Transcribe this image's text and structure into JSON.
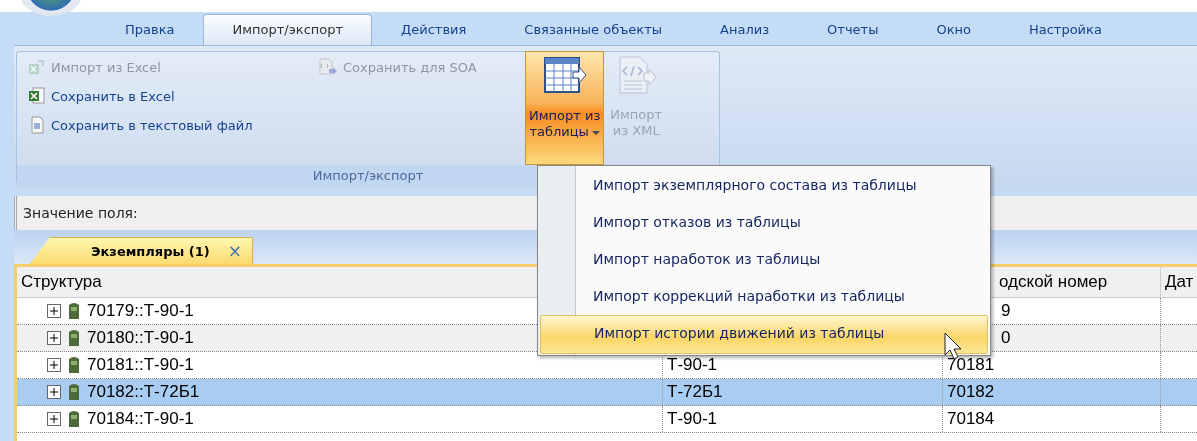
{
  "ribbon_tabs": [
    {
      "label": "Правка",
      "selected": false
    },
    {
      "label": "Импорт/экспорт",
      "selected": true
    },
    {
      "label": "Действия",
      "selected": false
    },
    {
      "label": "Связанные объекты",
      "selected": false
    },
    {
      "label": "Анализ",
      "selected": false
    },
    {
      "label": "Отчеты",
      "selected": false
    },
    {
      "label": "Окно",
      "selected": false
    },
    {
      "label": "Настройка",
      "selected": false
    }
  ],
  "ribbon_group": {
    "label": "Импорт/экспорт",
    "small_buttons": [
      {
        "label": "Импорт из Excel",
        "disabled": true
      },
      {
        "label": "Сохранить в Excel",
        "disabled": false
      },
      {
        "label": "Сохранить в текстовый файл",
        "disabled": false
      },
      {
        "label": "Сохранить для SOA",
        "disabled": true
      }
    ],
    "large_buttons": [
      {
        "label_line_1": "Импорт из",
        "label_line_2": "таблицы",
        "dropdown": true,
        "pressed": true,
        "disabled": false
      },
      {
        "label_line_1": "Импорт",
        "label_line_2": "из XML",
        "dropdown": false,
        "pressed": false,
        "disabled": true
      }
    ]
  },
  "dropdown_menu": [
    {
      "label": "Импорт экземплярного состава из таблицы",
      "highlighted": false
    },
    {
      "label": "Импорт отказов из таблицы",
      "highlighted": false
    },
    {
      "label": "Импорт наработок из таблицы",
      "highlighted": false
    },
    {
      "label": "Импорт коррекций наработки из таблицы",
      "highlighted": false
    },
    {
      "label": "Импорт истории движений из таблицы",
      "highlighted": true
    }
  ],
  "field_bar": {
    "label": "Значение поля:"
  },
  "document_tabs": [
    {
      "label": "Экземпляры (1)",
      "selected": true,
      "close": "×"
    }
  ],
  "table": {
    "columns": [
      "Структура",
      "одской номер",
      "Дат"
    ],
    "rows": [
      {
        "structure": "70179::Т-90-1",
        "column_3": "9",
        "selected": false
      },
      {
        "structure": "70180::Т-90-1",
        "column_3": "0",
        "selected": false
      },
      {
        "structure": "70181::Т-90-1",
        "column_2": "Т-90-1",
        "column_3": "70181",
        "selected": false
      },
      {
        "structure": "70182::Т-72Б1",
        "column_2": "Т-72Б1",
        "column_3": "70182",
        "selected": true
      },
      {
        "structure": "70184::Т-90-1",
        "column_2": "Т-90-1",
        "column_3": "70184",
        "selected": false
      }
    ]
  }
}
